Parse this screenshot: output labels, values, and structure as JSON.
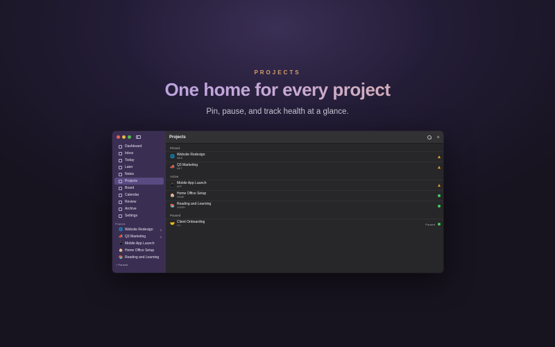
{
  "hero": {
    "eyebrow": "PROJECTS",
    "title": "One home for every project",
    "subtitle": "Pin, pause, and track health at a glance."
  },
  "sidebar": {
    "nav": [
      {
        "label": "Dashboard",
        "icon": "dashboard-icon"
      },
      {
        "label": "Inbox",
        "icon": "inbox-icon"
      },
      {
        "label": "Today",
        "icon": "today-icon"
      },
      {
        "label": "Later",
        "icon": "later-icon"
      },
      {
        "label": "Notes",
        "icon": "notes-icon"
      },
      {
        "label": "Projects",
        "icon": "folder-icon",
        "active": true
      },
      {
        "label": "Board",
        "icon": "board-icon"
      },
      {
        "label": "Calendar",
        "icon": "calendar-icon"
      },
      {
        "label": "Review",
        "icon": "review-icon"
      },
      {
        "label": "Archive",
        "icon": "archive-icon"
      },
      {
        "label": "Settings",
        "icon": "gear-icon"
      }
    ],
    "projects_label": "Projects",
    "projects": [
      {
        "emoji": "🌐",
        "label": "Website Redesign",
        "count": "3"
      },
      {
        "emoji": "📣",
        "label": "Q3 Marketing",
        "count": "3"
      },
      {
        "emoji": "📱",
        "label": "Mobile App Launch",
        "count": ""
      },
      {
        "emoji": "🏠",
        "label": "Home Office Setup",
        "count": ""
      },
      {
        "emoji": "📚",
        "label": "Reading and Learning",
        "count": ""
      }
    ],
    "paused_label": "> Paused"
  },
  "main": {
    "title": "Projects",
    "groups": [
      {
        "label": "Pinned",
        "rows": [
          {
            "emoji": "🌐",
            "name": "Website Redesign",
            "code": "WEB",
            "status": "",
            "health": "warning"
          },
          {
            "emoji": "📣",
            "name": "Q3 Marketing",
            "code": "MKT",
            "status": "",
            "health": "warning"
          }
        ]
      },
      {
        "label": "Active",
        "rows": [
          {
            "emoji": "📱",
            "name": "Mobile App Launch",
            "code": "APP",
            "status": "",
            "health": "warning"
          },
          {
            "emoji": "🏠",
            "name": "Home Office Setup",
            "code": "HOME",
            "status": "",
            "health": "ok"
          },
          {
            "emoji": "📚",
            "name": "Reading and Learning",
            "code": "LEARN",
            "status": "",
            "health": "ok"
          }
        ]
      },
      {
        "label": "Paused",
        "rows": [
          {
            "emoji": "🤝",
            "name": "Client Onboarding",
            "code": "CLI",
            "status": "Paused",
            "health": "ok"
          }
        ]
      }
    ]
  },
  "colors": {
    "accent": "#5a4a82",
    "warning": "#e89a2a",
    "ok": "#3fcf5a",
    "eyebrow": "#d9a06a"
  }
}
